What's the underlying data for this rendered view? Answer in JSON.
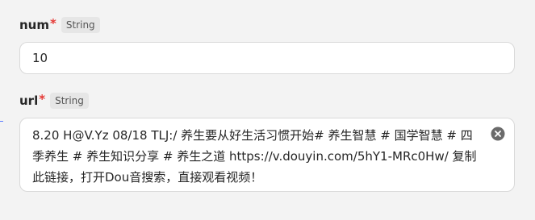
{
  "fields": {
    "num": {
      "label": "num",
      "required_mark": "*",
      "type": "String",
      "value": "10"
    },
    "url": {
      "label": "url",
      "required_mark": "*",
      "type": "String",
      "value": "8.20 H@V.Yz 08/18 TLJ:/ 养生要从好生活习惯开始# 养生智慧 # 国学智慧 # 四季养生 # 养生知识分享 # 养生之道  https://v.douyin.com/5hY1-MRc0Hw/ 复制此链接，打开Dou音搜索，直接观看视频！",
      "clear_icon": "clear-circle-icon"
    }
  },
  "colors": {
    "required": "#e53935",
    "background": "#f3f3f3",
    "input_border": "#d9d9d9",
    "clear_icon": "#6b6b6b"
  }
}
